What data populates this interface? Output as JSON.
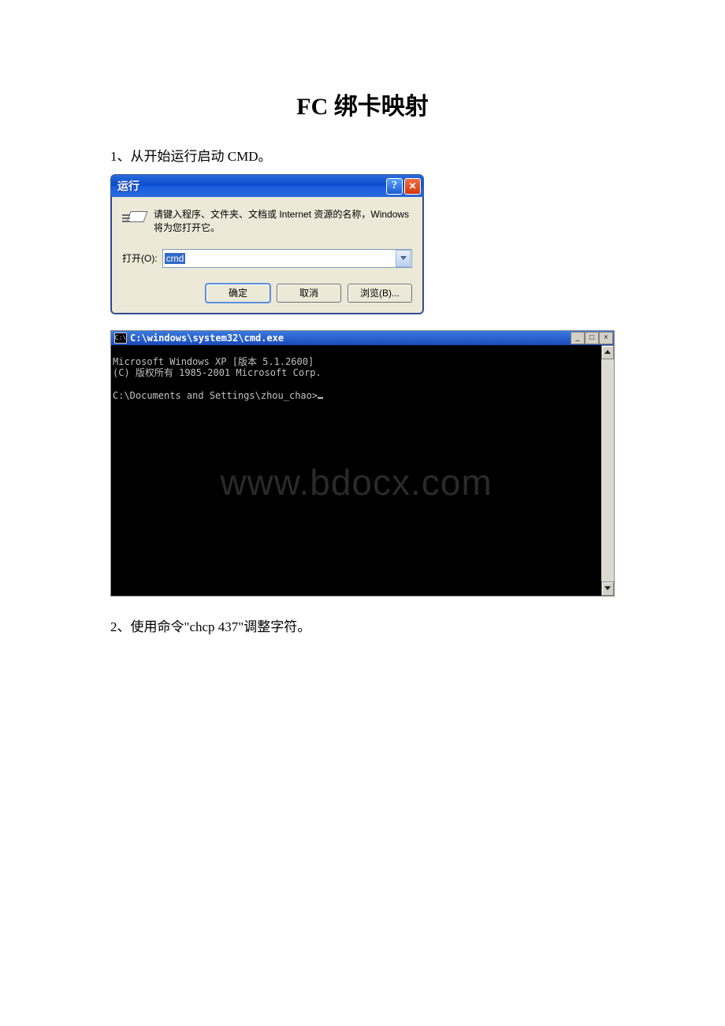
{
  "doc": {
    "title": "FC 绑卡映射",
    "step1": "1、从开始运行启动 CMD。",
    "step2": "2、使用命令\"chcp 437\"调整字符。"
  },
  "runDialog": {
    "title": "运行",
    "message": "请键入程序、文件夹、文档或 Internet 资源的名称，Windows 将为您打开它。",
    "openLabel": "打开(O):",
    "inputValue": "cmd",
    "buttons": {
      "ok": "确定",
      "cancel": "取消",
      "browse": "浏览(B)..."
    }
  },
  "cmdWindow": {
    "title": "C:\\windows\\system32\\cmd.exe",
    "iconText": "C:\\",
    "lines": {
      "l1": "Microsoft Windows XP [版本 5.1.2600]",
      "l2": "(C) 版权所有 1985-2001 Microsoft Corp.",
      "prompt": "C:\\Documents and Settings\\zhou_chao>"
    },
    "watermark": "www.bdocx.com",
    "minimize": "_",
    "maximize": "□",
    "close": "×"
  }
}
